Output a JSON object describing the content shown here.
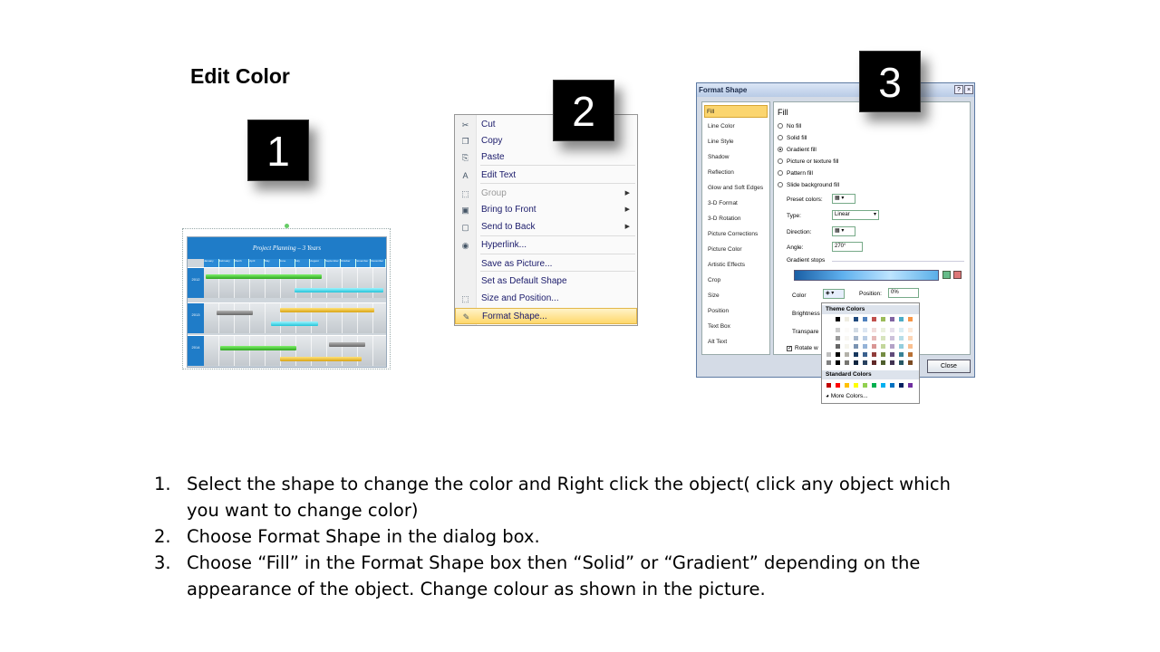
{
  "slide": {
    "title": "Edit Color",
    "badges": [
      "1",
      "2",
      "3"
    ]
  },
  "gantt": {
    "title": "Project Planning – 3 Years",
    "months": [
      "January",
      "February",
      "March",
      "April",
      "May",
      "June",
      "July",
      "August",
      "September",
      "October",
      "November",
      "December"
    ],
    "years": [
      "2012",
      "2013",
      "2014"
    ],
    "colors": {
      "header": "#1f7cc8",
      "green": "#3fbf2f",
      "cyan": "#3fd6e8",
      "gold": "#e6b82a",
      "gray": "#7a7a7a"
    }
  },
  "context_menu": {
    "items": [
      {
        "label": "Cut",
        "icon": "scissors-icon",
        "glyph": "✂"
      },
      {
        "label": "Copy",
        "icon": "copy-icon",
        "glyph": "❐"
      },
      {
        "label": "Paste",
        "icon": "paste-icon",
        "glyph": "⎘"
      },
      {
        "label": "Edit Text",
        "icon": "edit-text-icon",
        "glyph": "A"
      },
      {
        "label": "Group",
        "icon": "group-icon",
        "glyph": "⬚"
      },
      {
        "label": "Bring to Front",
        "icon": "bring-to-front-icon",
        "glyph": "▣"
      },
      {
        "label": "Send to Back",
        "icon": "send-to-back-icon",
        "glyph": "▢"
      },
      {
        "label": "Hyperlink...",
        "icon": "hyperlink-icon",
        "glyph": "◉"
      },
      {
        "label": "Save as Picture..."
      },
      {
        "label": "Set as Default Shape"
      },
      {
        "label": "Size and Position...",
        "icon": "size-position-icon",
        "glyph": "⬚"
      },
      {
        "label": "Format Shape...",
        "icon": "format-shape-icon",
        "glyph": "✎"
      }
    ]
  },
  "dialog": {
    "title": "Format Shape",
    "help": "?",
    "close_x": "×",
    "nav": [
      "Fill",
      "Line Color",
      "Line Style",
      "Shadow",
      "Reflection",
      "Glow and Soft Edges",
      "3-D Format",
      "3-D Rotation",
      "Picture Corrections",
      "Picture Color",
      "Artistic Effects",
      "Crop",
      "Size",
      "Position",
      "Text Box",
      "Alt Text"
    ],
    "fill_heading": "Fill",
    "options": [
      "No fill",
      "Solid fill",
      "Gradient fill",
      "Picture or texture fill",
      "Pattern fill",
      "Slide background fill"
    ],
    "selected_option": "Gradient fill",
    "preset_label": "Preset colors:",
    "type_label": "Type:",
    "type_value": "Linear",
    "direction_label": "Direction:",
    "angle_label": "Angle:",
    "angle_value": "270°",
    "stops_label": "Gradient stops",
    "color_label": "Color",
    "position_label": "Position:",
    "position_value": "0%",
    "brightness_label": "Brightness",
    "transparency_label": "Transpare",
    "rotate_label": "Rotate w",
    "close_button": "Close"
  },
  "color_popup": {
    "theme_header": "Theme Colors",
    "standard_header": "Standard Colors",
    "more": "More Colors...",
    "theme": [
      "#ffffff",
      "#000000",
      "#eeece1",
      "#1f497d",
      "#4f81bd",
      "#c0504d",
      "#9bbb59",
      "#8064a2",
      "#4bacc6",
      "#f79646"
    ],
    "standard": [
      "#c00000",
      "#ff0000",
      "#ffc000",
      "#ffff00",
      "#92d050",
      "#00b050",
      "#00b0f0",
      "#0070c0",
      "#002060",
      "#7030a0"
    ]
  },
  "instructions": [
    {
      "n": "1.",
      "text": "Select the shape to change the color and Right click the object( click any object which you want to change color)"
    },
    {
      "n": "2.",
      "text": "Choose Format Shape in the dialog box."
    },
    {
      "n": "3.",
      "text": "Choose “Fill” in the Format Shape box then “Solid” or “Gradient” depending on the appearance of the object. Change colour as shown in the picture."
    }
  ]
}
